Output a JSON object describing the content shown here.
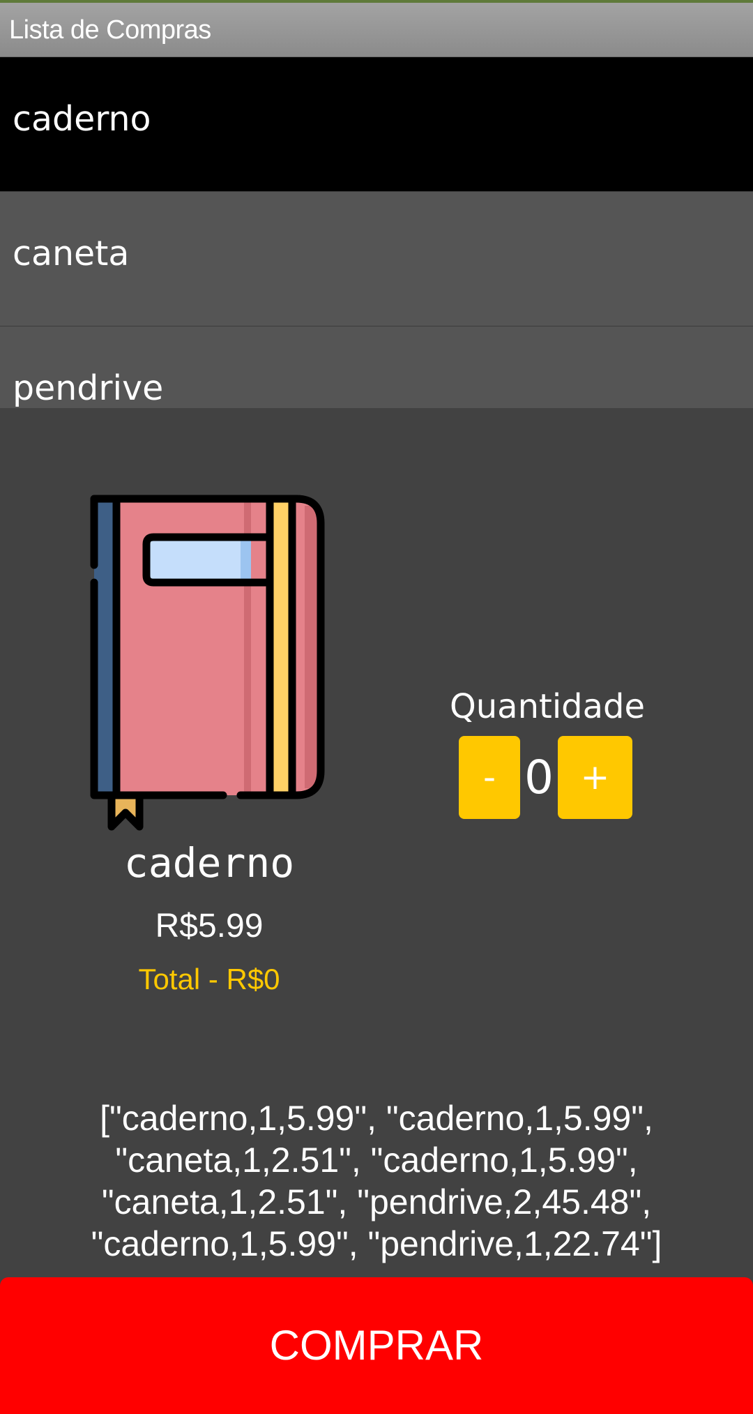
{
  "app": {
    "title": "Lista de Compras"
  },
  "list": {
    "items": [
      {
        "label": "caderno",
        "selected": true
      },
      {
        "label": "caneta",
        "selected": false
      },
      {
        "label": "pendrive",
        "selected": false
      }
    ]
  },
  "product": {
    "icon": "notebook-icon",
    "name": "caderno",
    "price": "R$5.99",
    "total": "Total - R$0"
  },
  "quantity": {
    "label": "Quantidade",
    "minus_label": "-",
    "value": "0",
    "plus_label": "+"
  },
  "cart": {
    "text": "[\"caderno,1,5.99\", \"caderno,1,5.99\", \"caneta,1,2.51\", \"caderno,1,5.99\", \"caneta,1,2.51\", \"pendrive,2,45.48\", \"caderno,1,5.99\", \"pendrive,1,22.74\"]"
  },
  "actions": {
    "buy_label": "COMPRAR"
  },
  "colors": {
    "background": "#424242",
    "list_item": "#555555",
    "list_selected": "#000000",
    "accent_yellow": "#ffc800",
    "buy_red": "#ff0000"
  }
}
